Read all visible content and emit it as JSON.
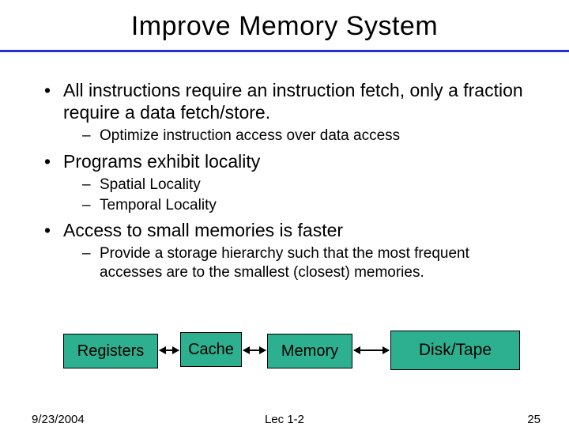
{
  "title": "Improve Memory System",
  "bullets": [
    {
      "text": "All instructions require an instruction fetch, only a fraction require a data fetch/store.",
      "sub": [
        "Optimize instruction access over data access"
      ]
    },
    {
      "text": "Programs exhibit locality",
      "sub": [
        "Spatial Locality",
        "Temporal Locality"
      ]
    },
    {
      "text": "Access to small memories is faster",
      "sub": [
        "Provide a storage hierarchy such that the most frequent accesses are to the smallest (closest) memories."
      ]
    }
  ],
  "hierarchy": {
    "registers": "Registers",
    "cache": "Cache",
    "memory": "Memory",
    "disk": "Disk/Tape"
  },
  "footer": {
    "date": "9/23/2004",
    "lecture": "Lec 1-2",
    "page": "25"
  },
  "colors": {
    "rule": "#2a2fd6",
    "box_fill": "#2db08f"
  }
}
